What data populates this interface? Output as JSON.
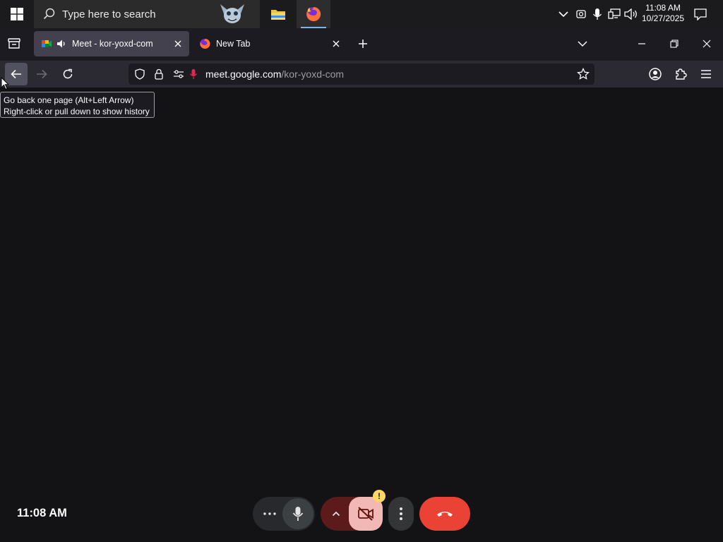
{
  "taskbar": {
    "search_placeholder": "Type here to search",
    "clock_time": "11:08 AM",
    "clock_date": "10/27/2025",
    "apps": [
      "file-explorer",
      "firefox"
    ]
  },
  "tabs": [
    {
      "title": "Meet - kor-yoxd-com",
      "active": true,
      "playing_audio": true
    },
    {
      "title": "New Tab",
      "active": false
    }
  ],
  "nav": {
    "url_host": "meet.google.com",
    "url_path": "/kor-yoxd-com"
  },
  "tooltip": {
    "line1": "Go back one page (Alt+Left Arrow)",
    "line2": "Right-click or pull down to show history"
  },
  "meet": {
    "time": "11:08 AM",
    "camera_warning": "!"
  },
  "colors": {
    "end_call": "#ea4335",
    "mic_on": "#3c4043",
    "present_bg": "#5c1a1a",
    "camera_off": "#f2b8b5",
    "warning": "#fdd663"
  }
}
